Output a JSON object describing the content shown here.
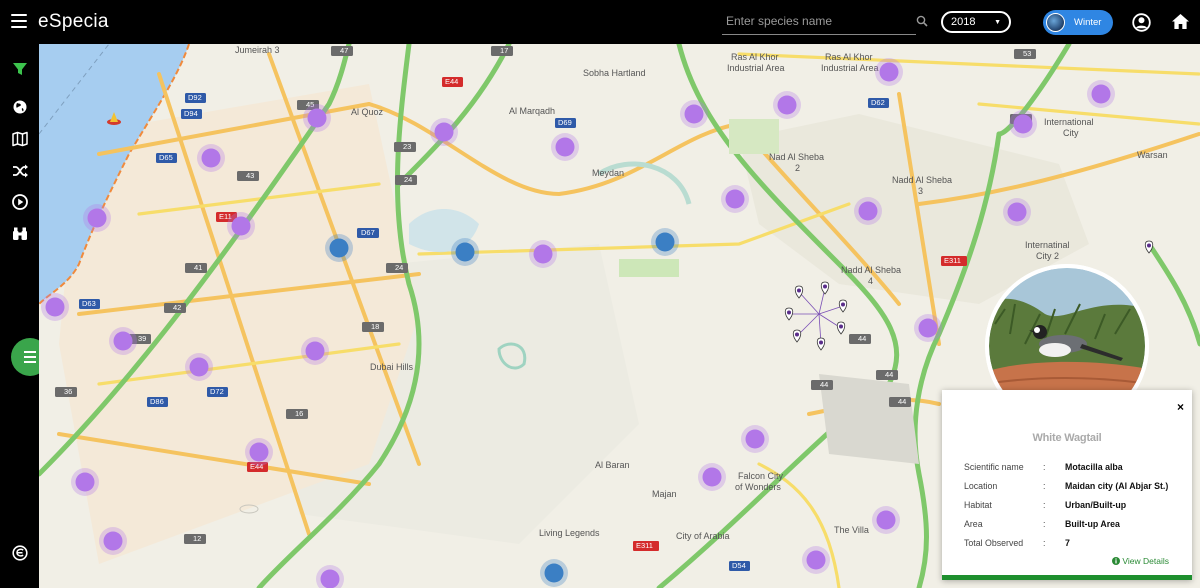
{
  "app": {
    "title": "eSpecia"
  },
  "search": {
    "placeholder": "Enter species name"
  },
  "year": {
    "selected": "2018"
  },
  "season": {
    "label": "Winter"
  },
  "sidebar": {
    "icons": [
      "filter-icon",
      "globe-icon",
      "map-icon",
      "shuffle-icon",
      "play-icon",
      "binoculars-icon",
      "especia-logo-icon"
    ]
  },
  "map": {
    "labels": [
      {
        "id": "jumeirah3",
        "text": "Jumeirah 3"
      },
      {
        "id": "sobha",
        "text": "Sobha Hartland"
      },
      {
        "id": "raskhor1",
        "text": "Ras Al Khor"
      },
      {
        "id": "raskhor1b",
        "text": "Industrial Area"
      },
      {
        "id": "raskhor2",
        "text": "Ras Al Khor"
      },
      {
        "id": "raskhor2b",
        "text": "Industrial Area"
      },
      {
        "id": "alquoz",
        "text": "Al Quoz"
      },
      {
        "id": "almarqadh",
        "text": "Al Marqadh"
      },
      {
        "id": "meydan",
        "text": "Meydan"
      },
      {
        "id": "nadsheba2",
        "text": "Nad Al Sheba"
      },
      {
        "id": "nadsheba2n",
        "text": "2"
      },
      {
        "id": "naddsheba3",
        "text": "Nadd Al Sheba"
      },
      {
        "id": "naddsheba3n",
        "text": "3"
      },
      {
        "id": "internationalcity",
        "text": "International"
      },
      {
        "id": "internationalcityb",
        "text": "City"
      },
      {
        "id": "warsan",
        "text": "Warsan"
      },
      {
        "id": "intcity2",
        "text": "Internatinal"
      },
      {
        "id": "intcity2b",
        "text": "City 2"
      },
      {
        "id": "naddsheba4",
        "text": "Nadd Al Sheba"
      },
      {
        "id": "naddsheba4n",
        "text": "4"
      },
      {
        "id": "dubaihills",
        "text": "Dubai Hills"
      },
      {
        "id": "albaran",
        "text": "Al Baran"
      },
      {
        "id": "majan",
        "text": "Majan"
      },
      {
        "id": "falcon",
        "text": "Falcon City"
      },
      {
        "id": "falconb",
        "text": "of Wonders"
      },
      {
        "id": "livinglegends",
        "text": "Living Legends"
      },
      {
        "id": "cityofarabia",
        "text": "City of Arabia"
      },
      {
        "id": "thevilla",
        "text": "The Villa"
      }
    ],
    "road_badges": [
      "47",
      "17",
      "53",
      "45",
      "D92",
      "D94",
      "23",
      "E44",
      "D69",
      "D62",
      "50",
      "D65",
      "43",
      "24",
      "D67",
      "E11",
      "41",
      "24",
      "D67",
      "E311",
      "E311",
      "42",
      "D63",
      "18",
      "39",
      "44",
      "36",
      "44",
      "D72",
      "D86",
      "44",
      "16",
      "E44",
      "12",
      "E311",
      "44",
      "D54"
    ]
  },
  "species_card": {
    "close_label": "×",
    "common_name": "White Wagtail",
    "fields": [
      {
        "label": "Scientific name",
        "value": "Motacilla alba"
      },
      {
        "label": "Location",
        "value": "Maidan city (Al Abjar St.)"
      },
      {
        "label": "Habitat",
        "value": "Urban/Built-up"
      },
      {
        "label": "Area",
        "value": "Built-up Area"
      },
      {
        "label": "Total Observed",
        "value": "7"
      }
    ],
    "separator": ":",
    "view_details_label": "View Details",
    "accent_color": "#1e8f2e"
  },
  "colors": {
    "cluster_purple": "#b277e8",
    "cluster_blue": "#3b7fc4",
    "water": "#a6cdf0",
    "primary_road": "#7fc86a",
    "secondary_road": "#f5c35f",
    "local_road": "#f7dd6a"
  }
}
